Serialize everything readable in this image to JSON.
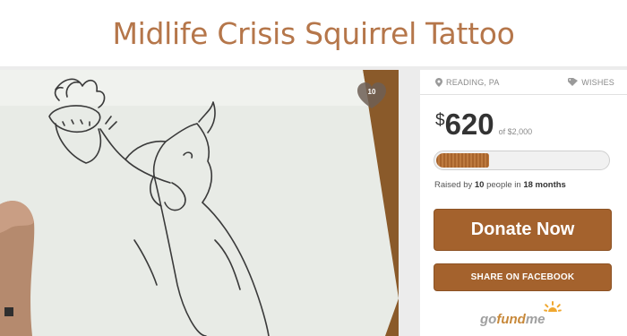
{
  "header": {
    "title": "Midlife Crisis Squirrel Tattoo"
  },
  "photo": {
    "alt": "squirrel-reaching-acorn-sketch",
    "heart_count": "10"
  },
  "campaign": {
    "location": "READING, PA",
    "category": "WISHES",
    "currency_symbol": "$",
    "raised_amount": "620",
    "goal_text": "of $2,000",
    "progress_fraction": 0.31,
    "raised_prefix": "Raised by ",
    "people_count": "10",
    "people_label": " people in ",
    "duration": "18 months"
  },
  "actions": {
    "donate_label": "Donate Now",
    "share_label": "SHARE ON FACEBOOK"
  },
  "brand": {
    "go": "go",
    "fund": "fund",
    "me": "me"
  },
  "colors": {
    "accent": "#a4622d",
    "title": "#b5764a",
    "logo_fund": "#c8893b"
  },
  "icons": {
    "location": "map-pin-icon",
    "category": "tag-icon",
    "heart": "heart-icon",
    "logo": "sunburst-icon"
  }
}
